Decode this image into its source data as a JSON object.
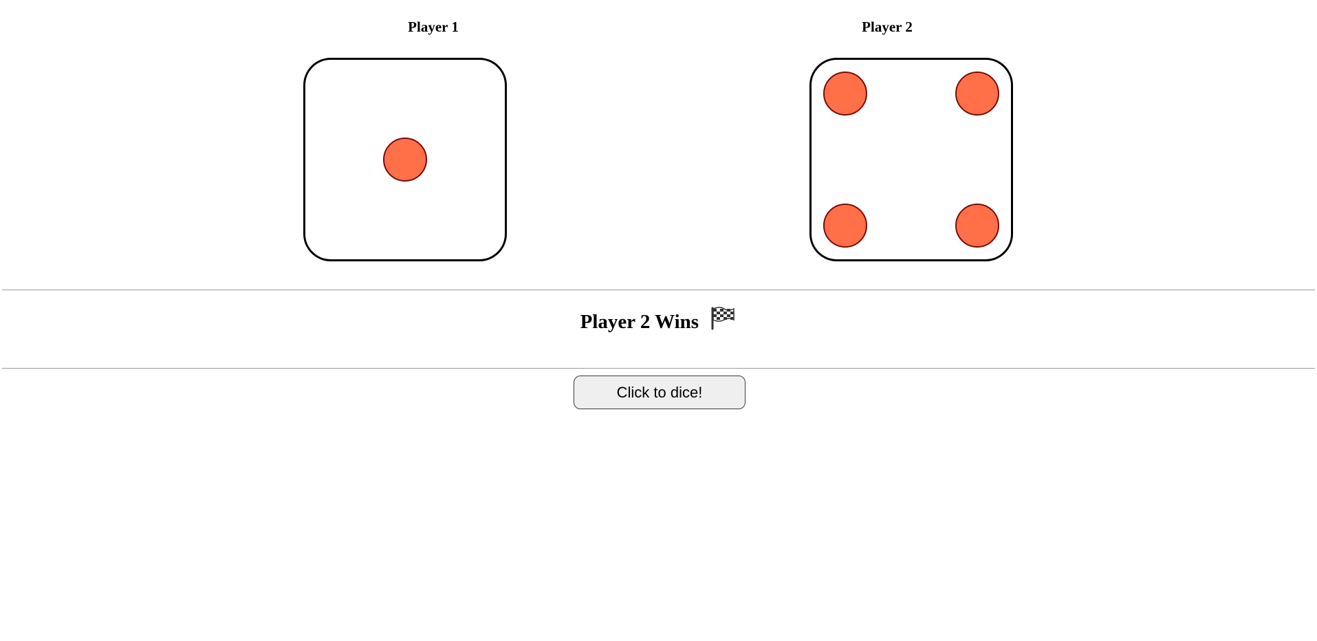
{
  "players": [
    {
      "title": "Player 1",
      "die_value": 1
    },
    {
      "title": "Player 2",
      "die_value": 4
    }
  ],
  "result": {
    "text": "Player 2 Wins",
    "icon": "checkered-flag-icon"
  },
  "roll_button": {
    "label": "Click to dice!"
  },
  "colors": {
    "pip_fill": "#ff7049",
    "pip_stroke": "#7a0a0a",
    "die_border": "#000000",
    "divider": "#9b9b9b",
    "button_bg": "#efefef"
  }
}
